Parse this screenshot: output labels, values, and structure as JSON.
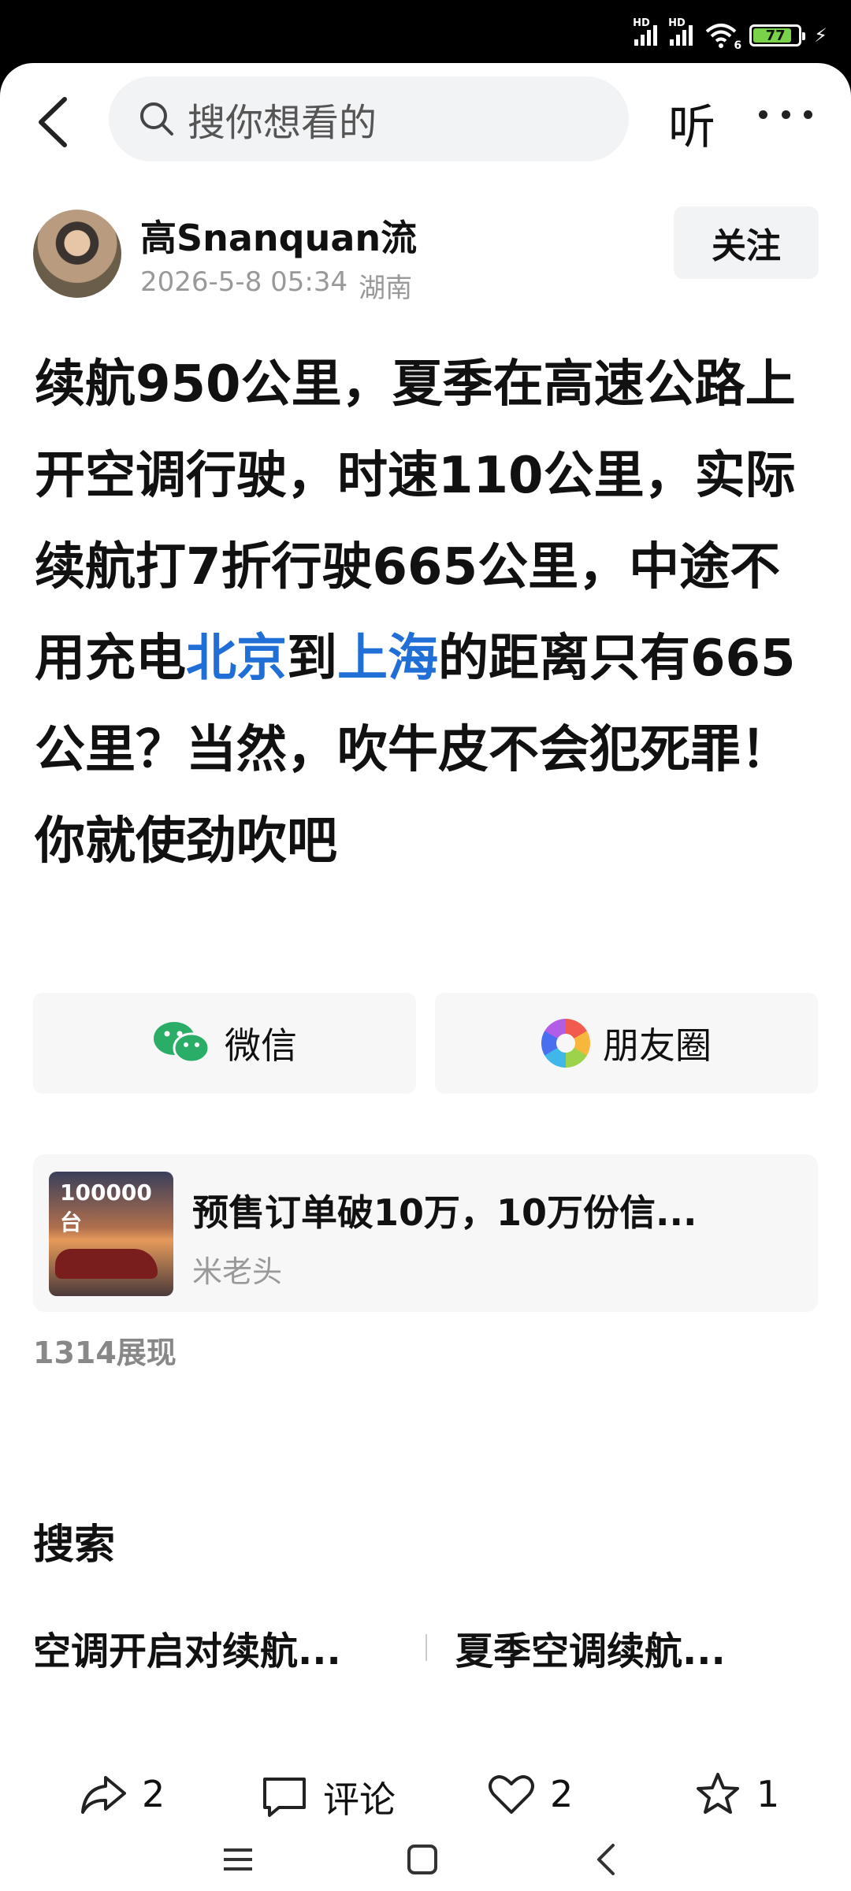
{
  "status_bar": {
    "battery": "77",
    "signal_1": "HD",
    "signal_2": "HD",
    "wifi_badge": "6"
  },
  "top_bar": {
    "search_placeholder": "搜你想看的",
    "listen_label": "听"
  },
  "author": {
    "name": "高Snanquan流",
    "date": "2026-5-8 05:34",
    "location": "湖南",
    "follow_label": "关注"
  },
  "article": {
    "part1": "续航950公里，夏季在高速公路上开空调行驶，时速110公里，实际续航打7折行驶665公里，中途不用充电",
    "link1": "北京",
    "part2": "到",
    "link2": "上海",
    "part3": "的距离只有665公里？当然，吹牛皮不会犯死罪！你就使劲吹吧"
  },
  "share": {
    "wechat": "微信",
    "moments": "朋友圈"
  },
  "recommendation": {
    "thumb_badge": "100000台",
    "title": "预售订单破10万，10万份信...",
    "author": "米老头"
  },
  "views": "1314展现",
  "search_section": {
    "heading": "搜索",
    "suggestions": [
      "空调开启对续航...",
      "夏季空调续航..."
    ]
  },
  "actions": {
    "share_count": "2",
    "comment_label": "评论",
    "like_count": "2",
    "favorite_count": "1"
  },
  "colors": {
    "link": "#1f6fd6",
    "battery": "#7ad24b"
  }
}
